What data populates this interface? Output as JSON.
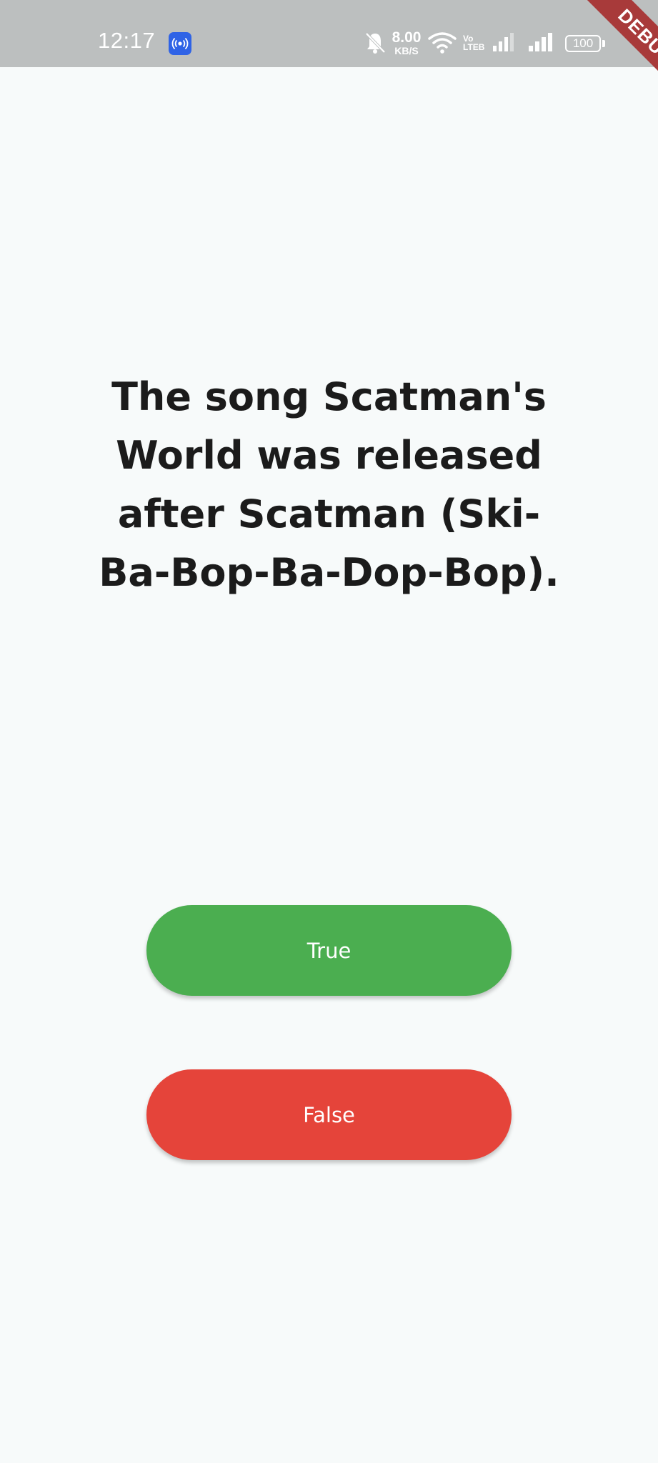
{
  "status_bar": {
    "time": "12:17",
    "net_speed_value": "8.00",
    "net_speed_unit": "KB/S",
    "volte_line1": "Vo",
    "volte_line2": "LTEB",
    "battery": "100"
  },
  "debug_banner": "DEBUG",
  "quiz": {
    "question": "The song Scatman's World was released after Scatman (Ski-Ba-Bop-Ba-Dop-Bop).",
    "true_label": "True",
    "false_label": "False"
  },
  "colors": {
    "true_button": "#4bae50",
    "false_button": "#e5443a",
    "background": "#f7fafa",
    "status_bar": "#bcbfbf"
  },
  "icons": [
    "hotspot-icon",
    "bell-off-icon",
    "wifi-icon",
    "signal-icon",
    "battery-icon"
  ]
}
